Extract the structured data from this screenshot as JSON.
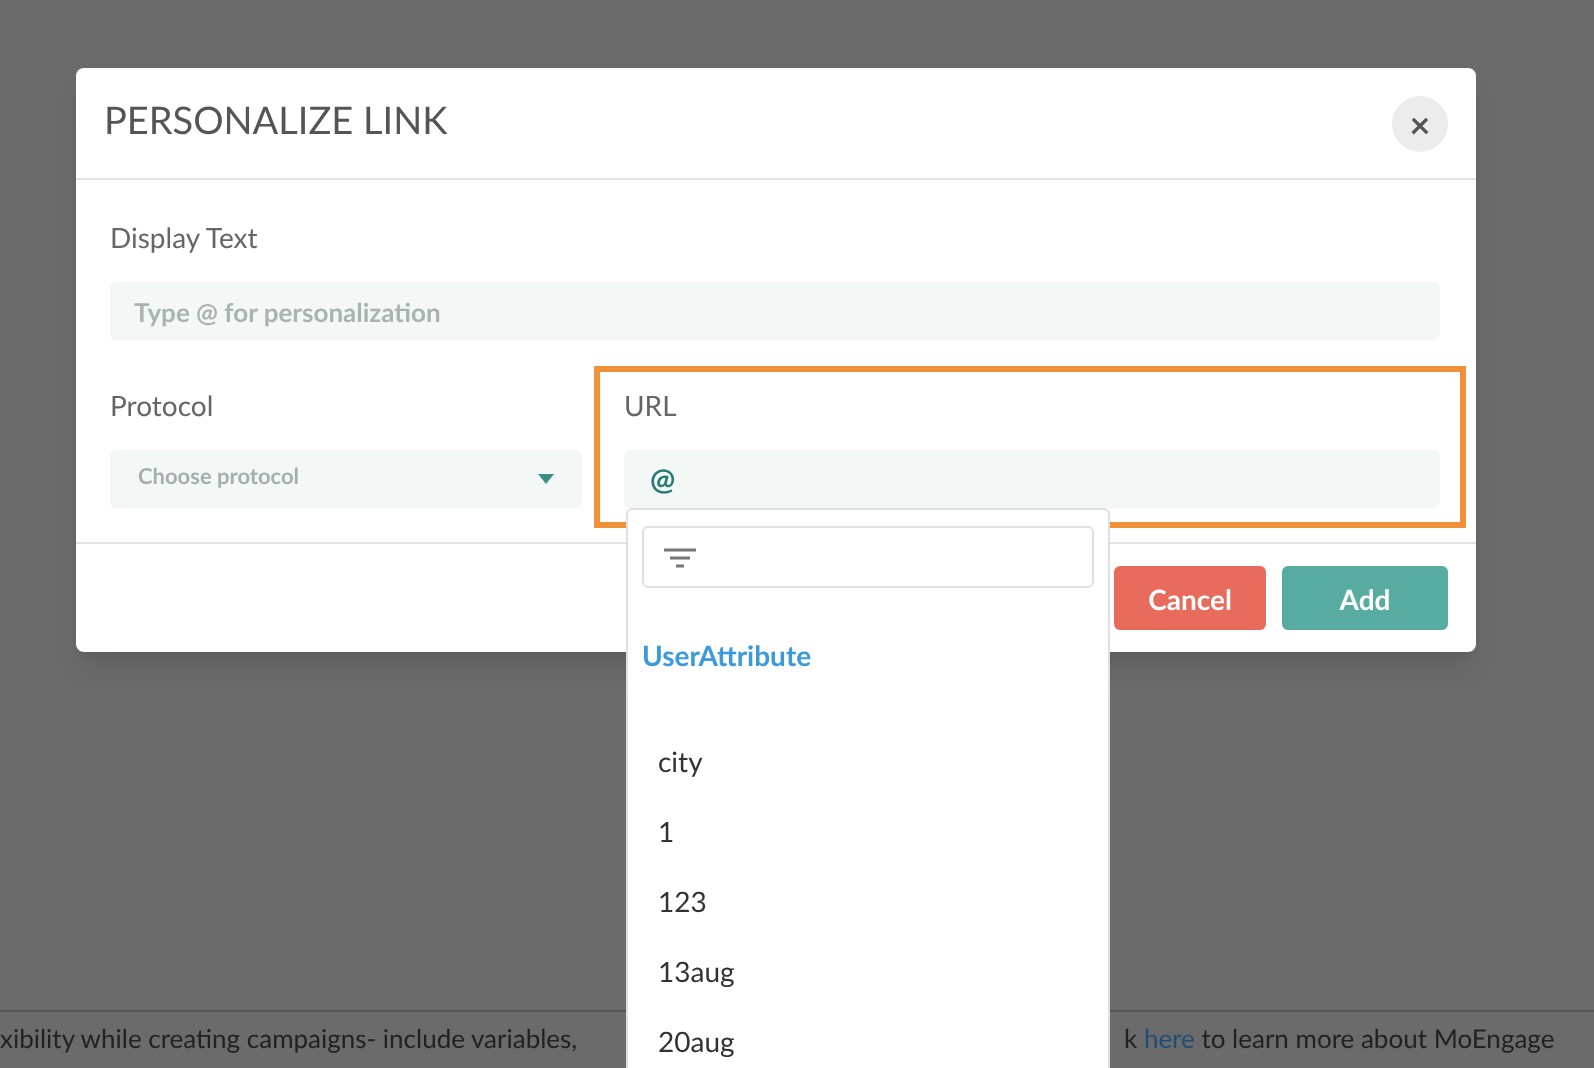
{
  "background": {
    "text_left": "xibility while creating campaigns- include variables,",
    "text_right_before": "k",
    "link": "here",
    "text_right_after": "to learn more about MoEngage"
  },
  "dialog": {
    "title": "PERSONALIZE LINK",
    "close": "×",
    "display_text": {
      "label": "Display Text",
      "placeholder": "Type @ for personalization"
    },
    "protocol": {
      "label": "Protocol",
      "placeholder": "Choose protocol"
    },
    "url": {
      "label": "URL",
      "value": "@",
      "highlighted": true
    },
    "buttons": [
      {
        "label": "Cancel",
        "kind": "cancel"
      },
      {
        "label": "Add",
        "kind": "primary"
      }
    ]
  },
  "dropdown": {
    "group": "UserAttribute",
    "items": [
      "city",
      "1",
      "123",
      "13aug",
      "20aug"
    ]
  }
}
